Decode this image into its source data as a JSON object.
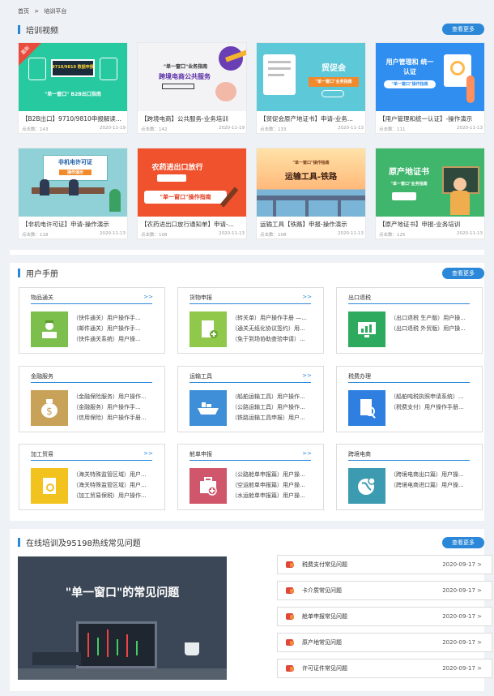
{
  "breadcrumb": {
    "home": "首页",
    "sep": ">",
    "current": "培训平台"
  },
  "more_label": "查看更多",
  "video_section": {
    "title": "培训视频",
    "cards": [
      {
        "title": "【B2B出口】9710/9810申报解读...",
        "views": "点击数：143",
        "date": "2020-11-19",
        "thumb_text": "9710/9810 数据申报",
        "thumb_sub": "\"单一窗口\" B2B出口指南",
        "badge": "最新"
      },
      {
        "title": "【跨境电商】公共服务-业务培训",
        "views": "点击数：142",
        "date": "2020-11-19",
        "thumb_text": "跨境电商公共服务",
        "thumb_sub": "\"单一窗口\"业务指南",
        "badge": ""
      },
      {
        "title": "【贸促会原产地证书】申请-业务...",
        "views": "点击数：133",
        "date": "2020-11-13",
        "thumb_text": "贸促会",
        "thumb_sub": "\"单一窗口\"业务指南",
        "badge": ""
      },
      {
        "title": "【用户管理和统一认证】-操作演示",
        "views": "点击数：111",
        "date": "2020-11-13",
        "thumb_text": "用户管理和 统一认证",
        "thumb_sub": "\"单一窗口\"操作指南",
        "badge": ""
      },
      {
        "title": "【非机电许可证】申请-操作演示",
        "views": "点击数：118",
        "date": "2020-11-13",
        "thumb_text": "非机电许可证",
        "thumb_sub": "操作演示",
        "badge": ""
      },
      {
        "title": "【农药进出口放行通知单】申请-...",
        "views": "点击数：108",
        "date": "2020-11-13",
        "thumb_text": "农药进出口放行",
        "thumb_sub": "\"单一窗口\"操作指南",
        "badge": ""
      },
      {
        "title": "运输工具【铁路】申报-操作演示",
        "views": "点击数：108",
        "date": "2020-11-13",
        "thumb_text": "运输工具-铁路",
        "thumb_sub": "\"单一窗口\"操作指南",
        "badge": ""
      },
      {
        "title": "【原产地证书】申报-业务培训",
        "views": "点击数：125",
        "date": "2020-11-13",
        "thumb_text": "原产地证书",
        "thumb_sub": "\"单一窗口\"业务指南",
        "badge": ""
      }
    ]
  },
  "manual_section": {
    "title": "用户手册",
    "cards": [
      {
        "title": "物品通关",
        "more": ">>",
        "items": [
          "（快件通关）用户操作手...",
          "（邮件通关）用户操作手...",
          "（快件通关系统）用户操..."
        ]
      },
      {
        "title": "货物申报",
        "more": ">>",
        "items": [
          "（转关单）用户操作手册 —...",
          "（通关无纸化协议签约）用...",
          "（免于到场协助查验申请）..."
        ]
      },
      {
        "title": "出口退税",
        "more": "",
        "items": [
          "（出口退税 生产版）用户操...",
          "（出口退税 外贸版）用户操..."
        ]
      },
      {
        "title": "金融服务",
        "more": "",
        "items": [
          "（金融保险服务）用户操作...",
          "（金融服务）用户操作手...",
          "（信用保险）用户操作手册..."
        ]
      },
      {
        "title": "运输工具",
        "more": ">>",
        "items": [
          "（船舶运输工具）用户操作...",
          "（公路运输工具）用户操作...",
          "（铁路运输工具申报）用户..."
        ]
      },
      {
        "title": "税费办理",
        "more": "",
        "items": [
          "（船舶吨税执照申请系统）...",
          "（税费支付）用户操作手册..."
        ]
      },
      {
        "title": "加工贸易",
        "more": ">>",
        "items": [
          "（海关特殊监管区域）用户...",
          "（海关特殊监管区域）用户...",
          "（加工贸易保税）用户操作..."
        ]
      },
      {
        "title": "舱单申报",
        "more": ">>",
        "items": [
          "（公路舱单申报篇）用户操...",
          "（空运舱单申报篇）用户操...",
          "（水运舱单申报篇）用户操..."
        ]
      },
      {
        "title": "跨境电商",
        "more": "",
        "items": [
          "（跨境电商出口篇）用户操...",
          "（跨境电商进口篇）用户操..."
        ]
      }
    ]
  },
  "faq_section": {
    "title": "在线培训及95198热线常见问题",
    "banner_text": "\"单一窗口\"的常见问题",
    "items": [
      {
        "label": "税费支付常见问题",
        "date": "2020-09-17  >"
      },
      {
        "label": "卡介质常见问题",
        "date": "2020-09-17  >"
      },
      {
        "label": "舱单申报常见问题",
        "date": "2020-09-17  >"
      },
      {
        "label": "原产地常见问题",
        "date": "2020-09-17  >"
      },
      {
        "label": "许可证件常见问题",
        "date": "2020-09-17  >"
      }
    ]
  },
  "colors": {
    "accent": "#2b88d8",
    "faq_icon": "#e0473b"
  }
}
